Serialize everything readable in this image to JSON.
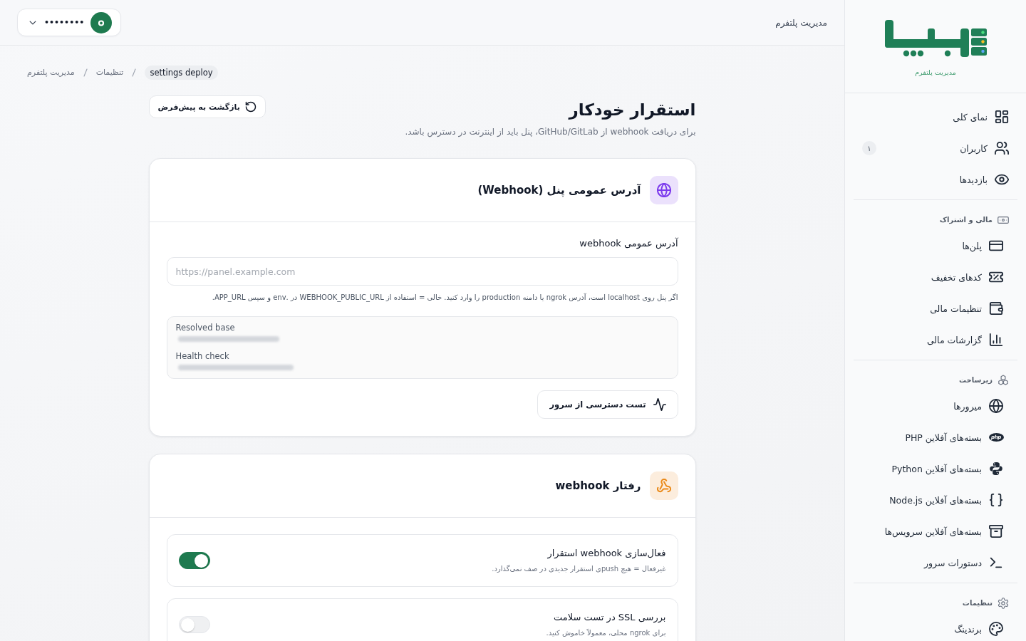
{
  "header": {
    "title": "مدیریت پلتفرم",
    "user": {
      "name": "••••••••"
    }
  },
  "sidebar": {
    "subtitle": "مدیریت پلتفرم",
    "groups": [
      {
        "items": [
          {
            "label": "نمای کلی",
            "selected": false
          },
          {
            "label": "کاربران",
            "badge": "۱",
            "selected": false
          },
          {
            "label": "بازدیدها",
            "selected": false
          }
        ]
      },
      {
        "title": "مالی و اشتراک",
        "items": [
          {
            "label": "پلن‌ها",
            "selected": false
          },
          {
            "label": "کدهای تخفیف",
            "selected": false
          },
          {
            "label": "تنظیمات مالی",
            "selected": false
          },
          {
            "label": "گزارشات مالی",
            "selected": false
          }
        ]
      },
      {
        "title": "زیرساخت",
        "items": [
          {
            "label": "میرورها",
            "selected": false
          },
          {
            "label": "بسته‌های آفلاین PHP",
            "icon_text": "php",
            "selected": false
          },
          {
            "label": "بسته‌های آفلاین Python",
            "selected": false
          },
          {
            "label": "بسته‌های آفلاین Node.js",
            "selected": false
          },
          {
            "label": "بسته‌های آفلاین سرویس‌ها",
            "selected": false
          },
          {
            "label": "دستورات سرور",
            "selected": false
          }
        ]
      },
      {
        "title": "تنظیمات",
        "items": [
          {
            "label": "برندینگ",
            "selected": false
          }
        ]
      }
    ]
  },
  "breadcrumb": [
    {
      "label": "settings deploy",
      "current": true
    },
    {
      "label": "تنظیمات",
      "current": false
    },
    {
      "label": "مدیریت پلتفرم",
      "current": false
    }
  ],
  "page": {
    "title": "استقرار خودکار",
    "subtitle": "برای دریافت webhook از GitHub/GitLab، پنل باید از اینترنت در دسترس باشد.",
    "reset_button": "بازگشت به پیش‌فرض"
  },
  "cards": [
    {
      "kind": "address",
      "title": "آدرس عمومی پنل (Webhook)",
      "color": "#7c3aed",
      "field": {
        "label": "آدرس عمومی webhook",
        "placeholder": "https://panel.example.com",
        "help": "اگر پنل روی localhost است، آدرس ngrok یا دامنه production را وارد کنید. خالی = استفاده از WEBHOOK_PUBLIC_URL در .env و سپس APP_URL."
      },
      "info": [
        {
          "label": "Resolved base"
        },
        {
          "label": "Health check"
        }
      ],
      "button": "تست دسترسی از سرور"
    },
    {
      "kind": "toggles",
      "title": "رفتار webhook",
      "color": "#ea8a1a",
      "toggles": [
        {
          "label": "فعال‌سازی webhook استقرار",
          "description": "غیرفعال = هیچ pushی استقرار جدیدی در صف نمی‌گذارد.",
          "on": true
        },
        {
          "label": "بررسی SSL در تست سلامت",
          "description": "برای ngrok محلی، معمولاً خاموش کنید.",
          "on": false
        }
      ]
    }
  ]
}
